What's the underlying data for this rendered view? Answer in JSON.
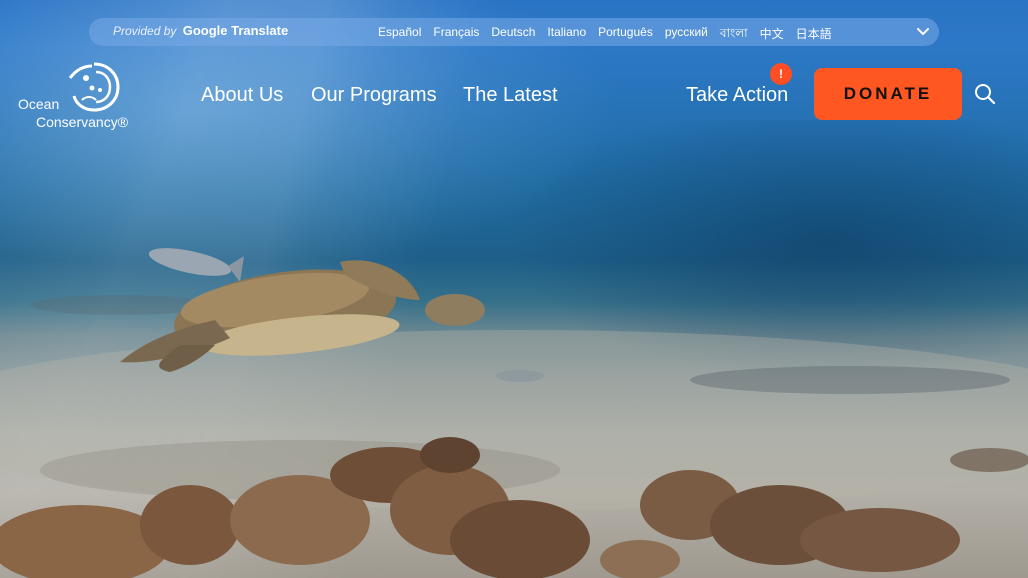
{
  "translate_bar": {
    "provided_by": "Provided by",
    "provider": "Google Translate",
    "languages": [
      "Español",
      "Français",
      "Deutsch",
      "Italiano",
      "Português",
      "русский",
      "বাংলা",
      "中文",
      "日本語"
    ]
  },
  "logo": {
    "line1": "Ocean",
    "line2": "Conservancy®"
  },
  "nav": {
    "about": "About Us",
    "programs": "Our Programs",
    "latest": "The Latest"
  },
  "take_action": {
    "label": "Take Action",
    "badge": "!"
  },
  "donate_label": "DONATE",
  "icons": {
    "search": "search-icon",
    "chevron": "chevron-down-icon"
  },
  "colors": {
    "donate": "#ff5722",
    "badge": "#ff4d24"
  }
}
